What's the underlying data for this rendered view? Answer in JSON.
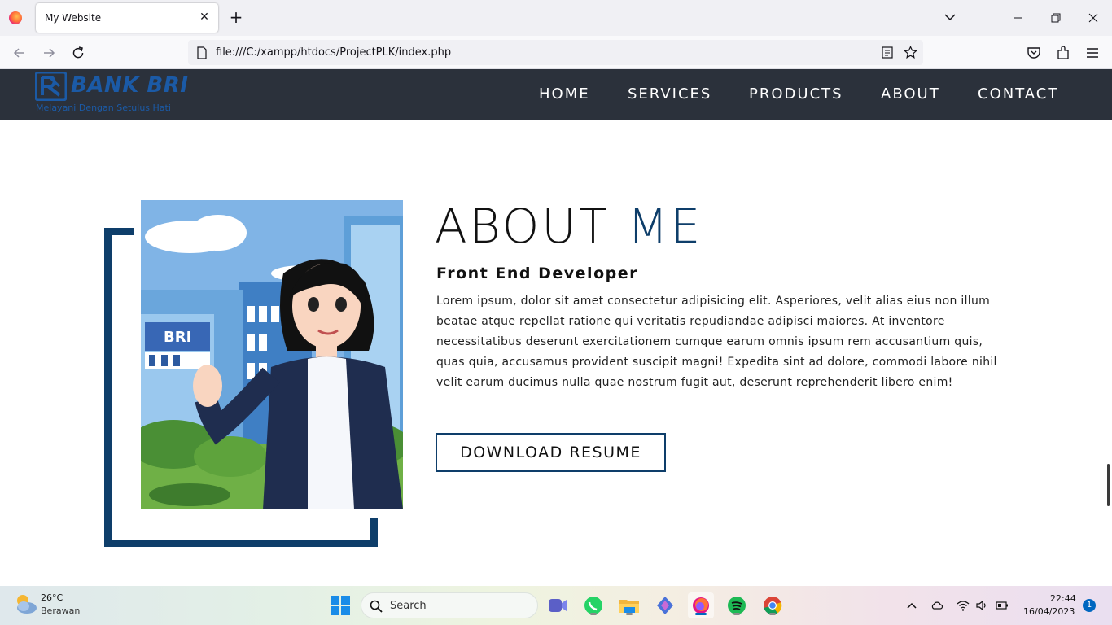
{
  "browser": {
    "tab_title": "My Website",
    "url": "file:///C:/xampp/htdocs/ProjectPLK/index.php"
  },
  "site": {
    "logo_text": "BANK BRI",
    "logo_tagline": "Melayani Dengan Setulus Hati",
    "nav": [
      "HOME",
      "SERVICES",
      "PRODUCTS",
      "ABOUT",
      "CONTACT"
    ],
    "brand_color": "#0e3e6a",
    "header_bg": "#2b313b"
  },
  "about": {
    "title_main": "ABOUT",
    "title_accent": "ME",
    "subtitle": "Front End Developer",
    "body": "Lorem ipsum, dolor sit amet consectetur adipisicing elit. Asperiores, velit alias eius non illum beatae atque repellat ratione qui veritatis repudiandae adipisci maiores. At inventore necessitatibus deserunt exercitationem cumque earum omnis ipsum rem accusantium quis, quas quia, accusamus provident suscipit magni! Expedita sint ad dolore, commodi labore nihil velit earum ducimus nulla quae nostrum fugit aut, deserunt reprehenderit libero enim!",
    "button": "DOWNLOAD RESUME",
    "image_sign": "BRI"
  },
  "taskbar": {
    "temperature": "26°C",
    "condition": "Berawan",
    "search_placeholder": "Search",
    "time": "22:44",
    "date": "16/04/2023",
    "notification_count": "1",
    "apps": [
      "meet-icon",
      "whatsapp-icon",
      "file-explorer-icon",
      "copilot-icon",
      "firefox-icon",
      "spotify-icon",
      "chrome-icon"
    ]
  }
}
